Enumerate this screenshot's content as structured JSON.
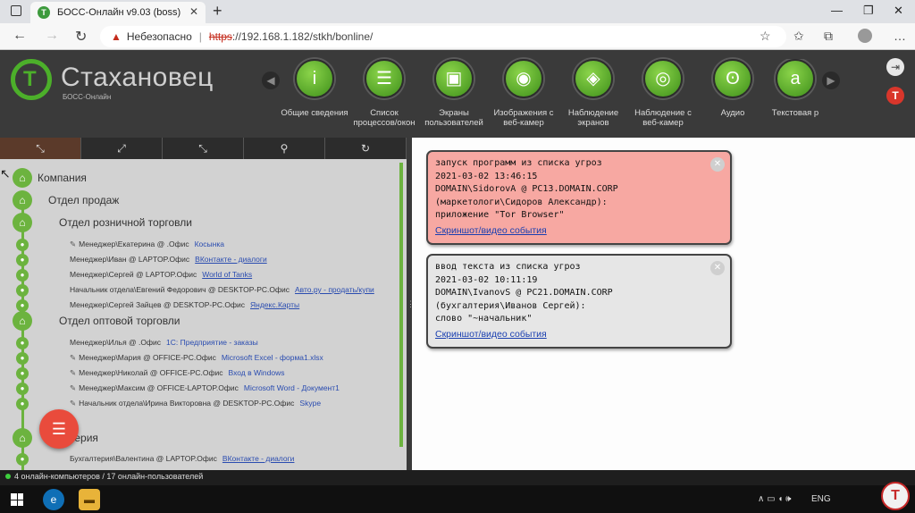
{
  "browser": {
    "tab_title": "БОСС-Онлайн v9.03 (boss)",
    "tab_favicon": "T",
    "tab_close": "✕",
    "new_tab": "+",
    "min": "—",
    "max": "❐",
    "close": "✕",
    "back": "←",
    "forward": "→",
    "reload": "↻",
    "security_warning": "Небезопасно",
    "url_scheme": "https",
    "url_rest": "://192.168.1.182/stkh/bonline/",
    "settings": "…"
  },
  "app": {
    "brand": "Стахановец",
    "brand_sub": "БОСС-Онлайн",
    "logo_letter": "T",
    "nav_prev": "◀",
    "nav_next": "▶",
    "modules": [
      {
        "label": "Общие сведения",
        "icon": "i"
      },
      {
        "label": "Список процессов/окон",
        "icon": "☰"
      },
      {
        "label": "Экраны пользователей",
        "icon": "▣"
      },
      {
        "label": "Изображения с веб-камер",
        "icon": "◉"
      },
      {
        "label": "Наблюдение экранов",
        "icon": "◈"
      },
      {
        "label": "Наблюдение с веб-камер",
        "icon": "◎"
      },
      {
        "label": "Аудио",
        "icon": "ʘ"
      },
      {
        "label": "Текстовая р",
        "icon": "a"
      }
    ],
    "logout_icon": "⇥",
    "app_logo_icon": "T"
  },
  "toolbar": {
    "buttons": [
      "⤡",
      "⤢",
      "⤡",
      "⚲",
      "↻"
    ]
  },
  "tree": {
    "root": "Компания",
    "dept": "Отдел продаж",
    "retail": "Отдел розничной торговли",
    "retail_users": [
      {
        "name": "Менеджер\\Екатерина @ .Офис",
        "app": "Косынка",
        "pencil": true,
        "underline": false
      },
      {
        "name": "Менеджер\\Иван @ LAPTOP.Офис",
        "app": "ВКонтакте - диалоги",
        "pencil": false,
        "underline": true
      },
      {
        "name": "Менеджер\\Сергей @ LAPTOP.Офис",
        "app": "World of Tanks",
        "pencil": false,
        "underline": true
      },
      {
        "name": "Начальник отдела\\Евгений Федорович @ DESKTOP-PC.Офис",
        "app": "Авто.ру - продать/купи",
        "pencil": false,
        "underline": true
      },
      {
        "name": "Менеджер\\Сергей Зайцев @ DESKTOP-PC.Офис",
        "app": "Яндекс.Карты",
        "pencil": false,
        "underline": true
      }
    ],
    "wholesale": "Отдел оптовой торговли",
    "wholesale_users": [
      {
        "name": "Менеджер\\Илья @ .Офис",
        "app": "1С: Предприятие - заказы",
        "pencil": false,
        "underline": false
      },
      {
        "name": "Менеджер\\Мария @ OFFICE-PC.Офис",
        "app": "Microsoft Excel - форма1.xlsx",
        "pencil": true,
        "underline": false
      },
      {
        "name": "Менеджер\\Николай @ OFFICE-PC.Офис",
        "app": "Вход в Windows",
        "pencil": true,
        "underline": false
      },
      {
        "name": "Менеджер\\Максим @ OFFICE-LAPTOP.Офис",
        "app": "Microsoft Word - Документ1",
        "pencil": true,
        "underline": false
      },
      {
        "name": "Начальник отдела\\Ирина Викторовна @ DESKTOP-PC.Офис",
        "app": "Skype",
        "pencil": true,
        "underline": false
      }
    ],
    "accounting": "терия",
    "accounting_users": [
      {
        "name": "Бухгалтерия\\Валентина @ LAPTOP.Офис",
        "app": "ВКонтакте - диалоги",
        "pencil": false,
        "underline": true
      }
    ],
    "fab_icon": "☰"
  },
  "events": [
    {
      "type": "red",
      "lines": [
        "запуск программ из списка угроз",
        "2021-03-02 13:46:15",
        "DOMAIN\\SidorovA @ PC13.DOMAIN.CORP",
        "(маркетологи\\Сидоров Александр):",
        "приложение \"Tor Browser\""
      ],
      "link": "Скриншот/видео события",
      "close": "✕"
    },
    {
      "type": "gray",
      "lines": [
        "ввод текста из списка угроз",
        "2021-03-02 10:11:19",
        "DOMAIN\\IvanovS @ PC21.DOMAIN.CORP",
        "(бухгалтерия\\Иванов Сергей):",
        "слово \"~начальник\""
      ],
      "link": "Скриншот/видео события",
      "close": "✕"
    }
  ],
  "status": {
    "text": "4 онлайн-компьютеров / 17 онлайн-пользователей"
  },
  "taskbar": {
    "lang": "ENG",
    "tray_icons": "∧  ▭  ◖  🕪"
  },
  "colors": {
    "accent": "#6cb33f",
    "alert_red": "#f7a8a2",
    "alert_gray": "#e6e6e6",
    "link": "#1a3fb0"
  }
}
